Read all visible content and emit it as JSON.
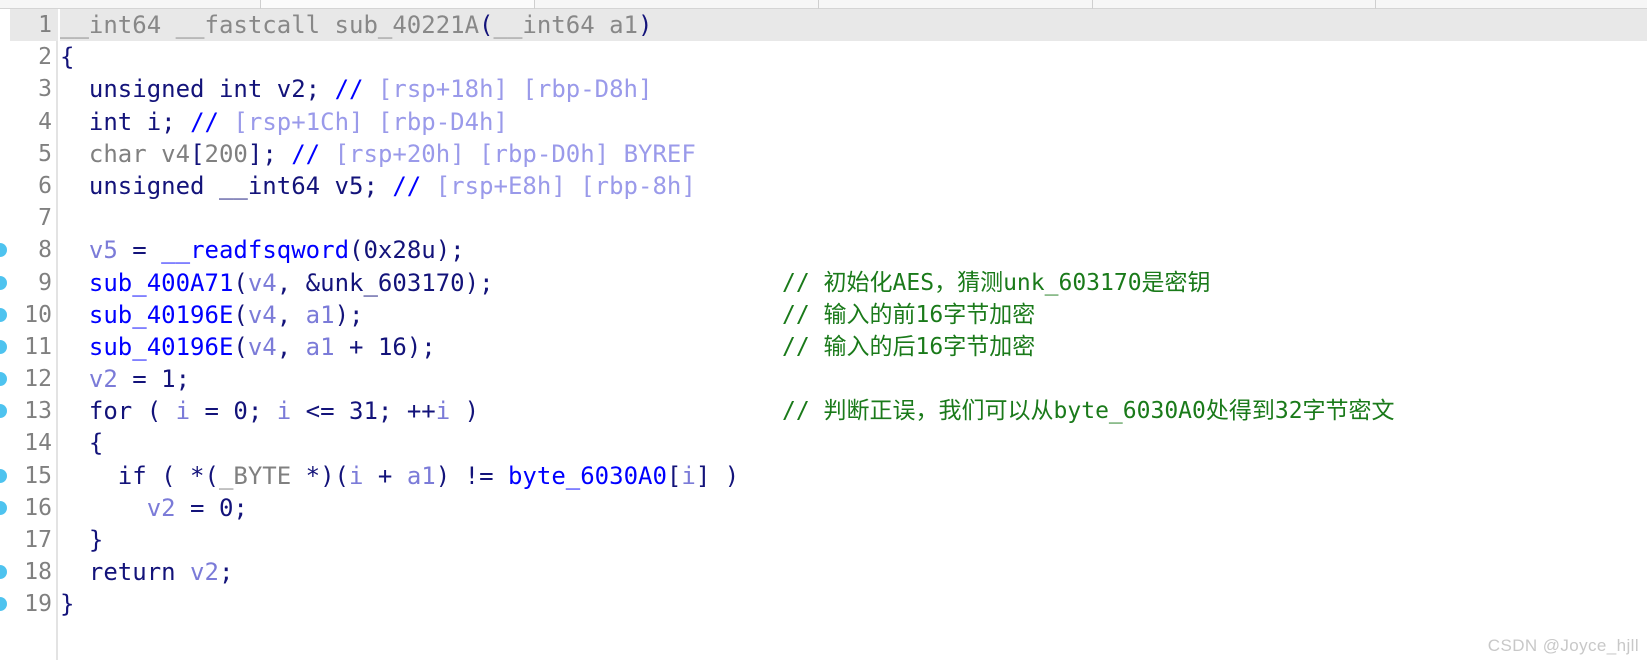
{
  "window": {
    "app": "IDA Pro Pseudocode View",
    "toolbar_segments": 6
  },
  "watermark": "CSDN @Joyce_hjll",
  "colors": {
    "background": "#ffffff",
    "highlight_row": "#e8e8e8",
    "line_number": "#808080",
    "punctuation": "#13137a",
    "function_name": "#0000ff",
    "variable": "#7b7bd8",
    "type_grey": "#808080",
    "stack_offset": "#9a9aea",
    "user_comment": "#1a7a1a",
    "breakpoint_dot": "#4ec3ef",
    "watermark": "#c8c8c8"
  },
  "code": {
    "language": "c",
    "function_name": "sub_40221A",
    "lines": [
      {
        "number": "1",
        "dot": false,
        "highlighted": true,
        "tokens": [
          {
            "text": "__int64 __fastcall ",
            "cls": "t-dim"
          },
          {
            "text": "sub_40221A",
            "cls": "t-dim"
          },
          {
            "text": "(",
            "cls": "t-plain"
          },
          {
            "text": "__int64 a1",
            "cls": "t-dim"
          },
          {
            "text": ")",
            "cls": "t-plain"
          }
        ],
        "comment": ""
      },
      {
        "number": "2",
        "dot": false,
        "highlighted": false,
        "tokens": [
          {
            "text": "{",
            "cls": "t-plain"
          }
        ],
        "comment": ""
      },
      {
        "number": "3",
        "dot": false,
        "highlighted": false,
        "tokens": [
          {
            "text": "  unsigned int ",
            "cls": "t-plain"
          },
          {
            "text": "v2",
            "cls": "t-plain"
          },
          {
            "text": "; ",
            "cls": "t-plain"
          },
          {
            "text": "//",
            "cls": "t-cmt"
          },
          {
            "text": " ",
            "cls": "t-plain"
          },
          {
            "text": "[rsp+18h] [rbp-D8h]",
            "cls": "t-off"
          }
        ],
        "comment": ""
      },
      {
        "number": "4",
        "dot": false,
        "highlighted": false,
        "tokens": [
          {
            "text": "  int ",
            "cls": "t-plain"
          },
          {
            "text": "i",
            "cls": "t-plain"
          },
          {
            "text": "; ",
            "cls": "t-plain"
          },
          {
            "text": "//",
            "cls": "t-cmt"
          },
          {
            "text": " ",
            "cls": "t-plain"
          },
          {
            "text": "[rsp+1Ch] [rbp-D4h]",
            "cls": "t-off"
          }
        ],
        "comment": ""
      },
      {
        "number": "5",
        "dot": false,
        "highlighted": false,
        "tokens": [
          {
            "text": "  char ",
            "cls": "t-grey"
          },
          {
            "text": "v4",
            "cls": "t-grey"
          },
          {
            "text": "[",
            "cls": "t-plain"
          },
          {
            "text": "200",
            "cls": "t-grey"
          },
          {
            "text": "]; ",
            "cls": "t-plain"
          },
          {
            "text": "//",
            "cls": "t-cmt"
          },
          {
            "text": " ",
            "cls": "t-plain"
          },
          {
            "text": "[rsp+20h] [rbp-D0h] BYREF",
            "cls": "t-off"
          }
        ],
        "comment": ""
      },
      {
        "number": "6",
        "dot": false,
        "highlighted": false,
        "tokens": [
          {
            "text": "  unsigned __int64 ",
            "cls": "t-plain"
          },
          {
            "text": "v5",
            "cls": "t-plain"
          },
          {
            "text": "; ",
            "cls": "t-plain"
          },
          {
            "text": "//",
            "cls": "t-cmt"
          },
          {
            "text": " ",
            "cls": "t-plain"
          },
          {
            "text": "[rsp+E8h] [rbp-8h]",
            "cls": "t-off"
          }
        ],
        "comment": ""
      },
      {
        "number": "7",
        "dot": false,
        "highlighted": false,
        "tokens": [],
        "comment": ""
      },
      {
        "number": "8",
        "dot": true,
        "highlighted": false,
        "tokens": [
          {
            "text": "  ",
            "cls": "t-plain"
          },
          {
            "text": "v5",
            "cls": "t-var"
          },
          {
            "text": " = ",
            "cls": "t-plain"
          },
          {
            "text": "__readfsqword",
            "cls": "t-func"
          },
          {
            "text": "(",
            "cls": "t-plain"
          },
          {
            "text": "0x28u",
            "cls": "t-plain"
          },
          {
            "text": ");",
            "cls": "t-plain"
          }
        ],
        "comment": ""
      },
      {
        "number": "9",
        "dot": true,
        "highlighted": false,
        "tokens": [
          {
            "text": "  ",
            "cls": "t-plain"
          },
          {
            "text": "sub_400A71",
            "cls": "t-func"
          },
          {
            "text": "(",
            "cls": "t-plain"
          },
          {
            "text": "v4",
            "cls": "t-var"
          },
          {
            "text": ", &",
            "cls": "t-plain"
          },
          {
            "text": "unk_603170",
            "cls": "t-plain"
          },
          {
            "text": ");",
            "cls": "t-plain"
          }
        ],
        "comment": "// 初始化AES，猜测unk_603170是密钥"
      },
      {
        "number": "10",
        "dot": true,
        "highlighted": false,
        "tokens": [
          {
            "text": "  ",
            "cls": "t-plain"
          },
          {
            "text": "sub_40196E",
            "cls": "t-func"
          },
          {
            "text": "(",
            "cls": "t-plain"
          },
          {
            "text": "v4",
            "cls": "t-var"
          },
          {
            "text": ", ",
            "cls": "t-plain"
          },
          {
            "text": "a1",
            "cls": "t-var"
          },
          {
            "text": ");",
            "cls": "t-plain"
          }
        ],
        "comment": "// 输入的前16字节加密"
      },
      {
        "number": "11",
        "dot": true,
        "highlighted": false,
        "tokens": [
          {
            "text": "  ",
            "cls": "t-plain"
          },
          {
            "text": "sub_40196E",
            "cls": "t-func"
          },
          {
            "text": "(",
            "cls": "t-plain"
          },
          {
            "text": "v4",
            "cls": "t-var"
          },
          {
            "text": ", ",
            "cls": "t-plain"
          },
          {
            "text": "a1",
            "cls": "t-var"
          },
          {
            "text": " + ",
            "cls": "t-plain"
          },
          {
            "text": "16",
            "cls": "t-plain"
          },
          {
            "text": ");",
            "cls": "t-plain"
          }
        ],
        "comment": "// 输入的后16字节加密"
      },
      {
        "number": "12",
        "dot": true,
        "highlighted": false,
        "tokens": [
          {
            "text": "  ",
            "cls": "t-plain"
          },
          {
            "text": "v2",
            "cls": "t-var"
          },
          {
            "text": " = ",
            "cls": "t-plain"
          },
          {
            "text": "1",
            "cls": "t-plain"
          },
          {
            "text": ";",
            "cls": "t-plain"
          }
        ],
        "comment": ""
      },
      {
        "number": "13",
        "dot": true,
        "highlighted": false,
        "tokens": [
          {
            "text": "  for ( ",
            "cls": "t-plain"
          },
          {
            "text": "i",
            "cls": "t-var"
          },
          {
            "text": " = ",
            "cls": "t-plain"
          },
          {
            "text": "0",
            "cls": "t-plain"
          },
          {
            "text": "; ",
            "cls": "t-plain"
          },
          {
            "text": "i",
            "cls": "t-var"
          },
          {
            "text": " <= ",
            "cls": "t-plain"
          },
          {
            "text": "31",
            "cls": "t-plain"
          },
          {
            "text": "; ++",
            "cls": "t-plain"
          },
          {
            "text": "i",
            "cls": "t-var"
          },
          {
            "text": " )",
            "cls": "t-plain"
          }
        ],
        "comment": "// 判断正误，我们可以从byte_6030A0处得到32字节密文"
      },
      {
        "number": "14",
        "dot": false,
        "highlighted": false,
        "tokens": [
          {
            "text": "  {",
            "cls": "t-plain"
          }
        ],
        "comment": ""
      },
      {
        "number": "15",
        "dot": true,
        "highlighted": false,
        "tokens": [
          {
            "text": "    if ( *(",
            "cls": "t-plain"
          },
          {
            "text": "_BYTE",
            "cls": "t-grey"
          },
          {
            "text": " *)(",
            "cls": "t-plain"
          },
          {
            "text": "i",
            "cls": "t-var"
          },
          {
            "text": " + ",
            "cls": "t-plain"
          },
          {
            "text": "a1",
            "cls": "t-var"
          },
          {
            "text": ") != ",
            "cls": "t-plain"
          },
          {
            "text": "byte_6030A0",
            "cls": "t-func"
          },
          {
            "text": "[",
            "cls": "t-plain"
          },
          {
            "text": "i",
            "cls": "t-var"
          },
          {
            "text": "] )",
            "cls": "t-plain"
          }
        ],
        "comment": ""
      },
      {
        "number": "16",
        "dot": true,
        "highlighted": false,
        "tokens": [
          {
            "text": "      ",
            "cls": "t-plain"
          },
          {
            "text": "v2",
            "cls": "t-var"
          },
          {
            "text": " = ",
            "cls": "t-plain"
          },
          {
            "text": "0",
            "cls": "t-plain"
          },
          {
            "text": ";",
            "cls": "t-plain"
          }
        ],
        "comment": ""
      },
      {
        "number": "17",
        "dot": false,
        "highlighted": false,
        "tokens": [
          {
            "text": "  }",
            "cls": "t-plain"
          }
        ],
        "comment": ""
      },
      {
        "number": "18",
        "dot": true,
        "highlighted": false,
        "tokens": [
          {
            "text": "  return ",
            "cls": "t-plain"
          },
          {
            "text": "v2",
            "cls": "t-var"
          },
          {
            "text": ";",
            "cls": "t-plain"
          }
        ],
        "comment": ""
      },
      {
        "number": "19",
        "dot": true,
        "highlighted": false,
        "tokens": [
          {
            "text": "}",
            "cls": "t-plain"
          }
        ],
        "comment": ""
      }
    ]
  }
}
